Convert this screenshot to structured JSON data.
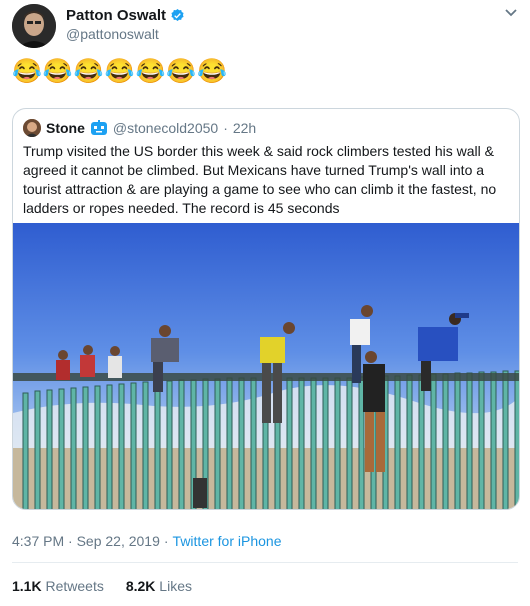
{
  "tweet": {
    "author_name": "Patton Oswalt",
    "author_handle": "@pattonoswalt",
    "body": "😂😂😂😂😂😂😂",
    "timestamp": "4:37 PM · Sep 22, 2019",
    "separator": "·",
    "source": "Twitter for iPhone",
    "retweets_count": "1.1K",
    "retweets_label": "Retweets",
    "likes_count": "8.2K",
    "likes_label": "Likes"
  },
  "quote": {
    "author_name": "Stone",
    "author_handle": "@stonecold2050",
    "dot": "·",
    "age": "22h",
    "text": "Trump visited the US border this week & said rock climbers tested his wall & agreed it cannot be climbed. But Mexicans have turned Trump's wall into a tourist attraction & are playing a game to see who can climb it the fastest, no ladders or ropes needed. The record is 45 seconds"
  },
  "colors": {
    "verified": "#1da1f2",
    "link": "#1b95e0",
    "secondary_text": "#657786",
    "border": "#ccd6dd"
  },
  "icons": {
    "verified": "verified-badge-icon",
    "menu": "chevron-down-icon"
  }
}
